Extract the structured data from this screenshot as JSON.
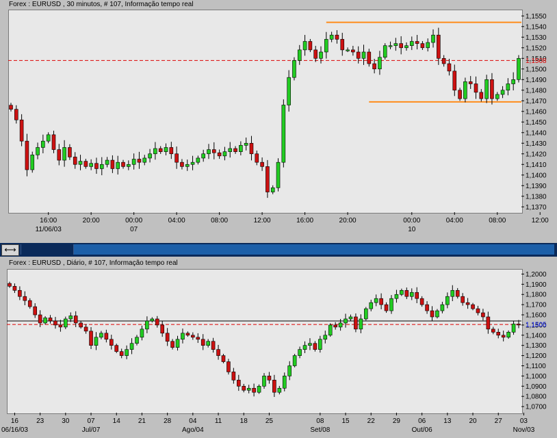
{
  "chart_data": [
    {
      "type": "candlestick",
      "title": "Forex : EURUSD , 30 minutos, # 107, Informação tempo real",
      "yticks": [
        "1,1550",
        "1,1540",
        "1,1530",
        "1,1520",
        "1,1510",
        "1,1500",
        "1,1490",
        "1,1480",
        "1,1470",
        "1,1460",
        "1,1450",
        "1,1440",
        "1,1430",
        "1,1420",
        "1,1410",
        "1,1400",
        "1,1390",
        "1,1380",
        "1,1370"
      ],
      "ylim": [
        1.1365,
        1.1556
      ],
      "xticks": [
        {
          "label": "16:00",
          "sub": "11/06/03",
          "i": 7
        },
        {
          "label": "20:00",
          "sub": "",
          "i": 15
        },
        {
          "label": "00:00",
          "sub": "07",
          "i": 23
        },
        {
          "label": "04:00",
          "sub": "",
          "i": 31
        },
        {
          "label": "08:00",
          "sub": "",
          "i": 39
        },
        {
          "label": "12:00",
          "sub": "",
          "i": 47
        },
        {
          "label": "16:00",
          "sub": "",
          "i": 55
        },
        {
          "label": "20:00",
          "sub": "",
          "i": 63
        },
        {
          "label": "00:00",
          "sub": "10",
          "i": 75
        },
        {
          "label": "04:00",
          "sub": "",
          "i": 83
        },
        {
          "label": "08:00",
          "sub": "",
          "i": 91
        },
        {
          "label": "12:00",
          "sub": "",
          "i": 99
        }
      ],
      "current_price": "1,1508",
      "current_value": 1.1508,
      "resistance": 1.1544,
      "support": 1.1469,
      "resistance_start_i": 59,
      "support_start_i": 67,
      "colors": {
        "up": "#22cc22",
        "down": "#cc1111",
        "level": "#ff8c1a",
        "price_line": "#dd0000",
        "price_label": "#dd0000",
        "bg": "#e8e8e8"
      },
      "closes": [
        1.1462,
        1.1452,
        1.1432,
        1.1405,
        1.1419,
        1.1426,
        1.1432,
        1.1438,
        1.1424,
        1.1414,
        1.1426,
        1.1417,
        1.141,
        1.1413,
        1.1408,
        1.1411,
        1.1406,
        1.141,
        1.1414,
        1.1406,
        1.1412,
        1.1408,
        1.141,
        1.1415,
        1.1412,
        1.1416,
        1.142,
        1.1425,
        1.1422,
        1.1426,
        1.142,
        1.1412,
        1.1408,
        1.141,
        1.1412,
        1.1416,
        1.142,
        1.1424,
        1.1421,
        1.1418,
        1.1422,
        1.1425,
        1.1422,
        1.1428,
        1.143,
        1.142,
        1.1412,
        1.1408,
        1.1384,
        1.1388,
        1.1412,
        1.1466,
        1.1492,
        1.1508,
        1.1518,
        1.1526,
        1.1518,
        1.151,
        1.1516,
        1.1528,
        1.1532,
        1.1528,
        1.1518,
        1.1518,
        1.1516,
        1.151,
        1.1516,
        1.1505,
        1.15,
        1.1511,
        1.1522,
        1.1522,
        1.1524,
        1.152,
        1.1522,
        1.1526,
        1.1524,
        1.152,
        1.1525,
        1.1532,
        1.151,
        1.1505,
        1.1498,
        1.148,
        1.1472,
        1.1488,
        1.1486,
        1.1478,
        1.1472,
        1.149,
        1.1472,
        1.1476,
        1.148,
        1.1486,
        1.149,
        1.151
      ],
      "note": ""
    },
    {
      "type": "candlestick",
      "title": "Forex : EURUSD , Diário, # 107, Informação tempo real",
      "yticks": [
        "1,2000",
        "1,1900",
        "1,1800",
        "1,1700",
        "1,1600",
        "1,1500",
        "1,1400",
        "1,1300",
        "1,1200",
        "1,1100",
        "1,1000",
        "1,0900",
        "1,0800",
        "1,0700"
      ],
      "ylim": [
        1.064,
        1.205
      ],
      "xticks": [
        {
          "label": "16",
          "sub": "06/16/03",
          "i": 1
        },
        {
          "label": "23",
          "sub": "",
          "i": 6
        },
        {
          "label": "30",
          "sub": "",
          "i": 11
        },
        {
          "label": "07",
          "sub": "Jul/07",
          "i": 16
        },
        {
          "label": "14",
          "sub": "",
          "i": 21
        },
        {
          "label": "21",
          "sub": "",
          "i": 26
        },
        {
          "label": "28",
          "sub": "",
          "i": 31
        },
        {
          "label": "04",
          "sub": "Ago/04",
          "i": 36
        },
        {
          "label": "11",
          "sub": "",
          "i": 41
        },
        {
          "label": "18",
          "sub": "",
          "i": 46
        },
        {
          "label": "25",
          "sub": "",
          "i": 51
        },
        {
          "label": "08",
          "sub": "Set/08",
          "i": 61
        },
        {
          "label": "15",
          "sub": "",
          "i": 66
        },
        {
          "label": "22",
          "sub": "",
          "i": 71
        },
        {
          "label": "29",
          "sub": "",
          "i": 76
        },
        {
          "label": "06",
          "sub": "Out/06",
          "i": 81
        },
        {
          "label": "13",
          "sub": "",
          "i": 86
        },
        {
          "label": "20",
          "sub": "",
          "i": 91
        },
        {
          "label": "27",
          "sub": "",
          "i": 96
        },
        {
          "label": "03",
          "sub": "Nov/03",
          "i": 101
        }
      ],
      "current_price": "1,1505",
      "current_value": 1.1505,
      "hline": 1.154,
      "colors": {
        "up": "#22cc22",
        "down": "#cc1111",
        "price_line": "#dd0000",
        "price_label": "#1a2aff",
        "hline": "#000000",
        "bg": "#e8e8e8"
      },
      "closes": [
        1.188,
        1.184,
        1.178,
        1.174,
        1.168,
        1.16,
        1.152,
        1.157,
        1.154,
        1.15,
        1.148,
        1.156,
        1.159,
        1.152,
        1.148,
        1.144,
        1.13,
        1.138,
        1.142,
        1.136,
        1.13,
        1.124,
        1.12,
        1.126,
        1.132,
        1.138,
        1.146,
        1.154,
        1.156,
        1.15,
        1.142,
        1.134,
        1.128,
        1.136,
        1.142,
        1.14,
        1.138,
        1.136,
        1.13,
        1.134,
        1.126,
        1.12,
        1.114,
        1.104,
        1.096,
        1.09,
        1.086,
        1.088,
        1.084,
        1.09,
        1.1,
        1.096,
        1.084,
        1.088,
        1.1,
        1.11,
        1.12,
        1.126,
        1.13,
        1.132,
        1.126,
        1.136,
        1.14,
        1.15,
        1.148,
        1.152,
        1.156,
        1.158,
        1.146,
        1.156,
        1.166,
        1.172,
        1.176,
        1.17,
        1.164,
        1.176,
        1.18,
        1.184,
        1.178,
        1.182,
        1.176,
        1.17,
        1.164,
        1.158,
        1.164,
        1.17,
        1.178,
        1.184,
        1.178,
        1.172,
        1.17,
        1.166,
        1.162,
        1.158,
        1.146,
        1.143,
        1.14,
        1.138,
        1.143,
        1.151,
        1.1505
      ]
    }
  ]
}
